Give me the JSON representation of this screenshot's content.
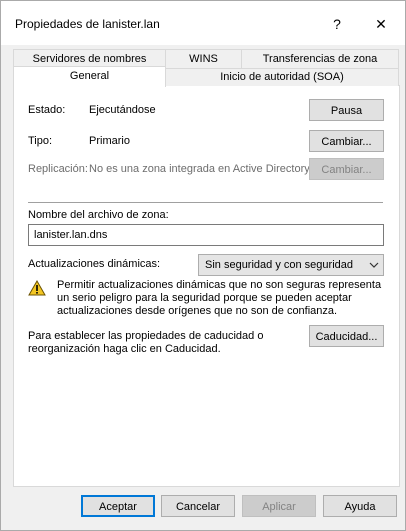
{
  "window": {
    "title": "Propiedades de lanister.lan",
    "help_label": "?",
    "close_label": "✕"
  },
  "tabs_back": [
    "Servidores de nombres",
    "WINS",
    "Transferencias de zona"
  ],
  "tabs_front": [
    "General",
    "Inicio de autoridad (SOA)"
  ],
  "general": {
    "status_label": "Estado:",
    "status_value": "Ejecutándose",
    "pause_button": "Pausa",
    "type_label": "Tipo:",
    "type_value": "Primario",
    "change_button": "Cambiar...",
    "replication_label": "Replicación:",
    "replication_value": "No es una zona integrada en Active Directory",
    "replication_change_button": "Cambiar...",
    "zone_file_label": "Nombre del archivo de zona:",
    "zone_file_value": "lanister.lan.dns",
    "dynamic_updates_label": "Actualizaciones dinámicas:",
    "dynamic_updates_value": "Sin seguridad y con seguridad",
    "warning_text": "Permitir actualizaciones dinámicas que no son seguras representa un serio peligro para la seguridad porque se pueden aceptar actualizaciones desde orígenes que no son de confianza.",
    "aging_text": "Para establecer las propiedades de caducidad o reorganización haga clic en Caducidad.",
    "aging_button": "Caducidad..."
  },
  "footer": {
    "ok": "Aceptar",
    "cancel": "Cancelar",
    "apply": "Aplicar",
    "help": "Ayuda"
  }
}
